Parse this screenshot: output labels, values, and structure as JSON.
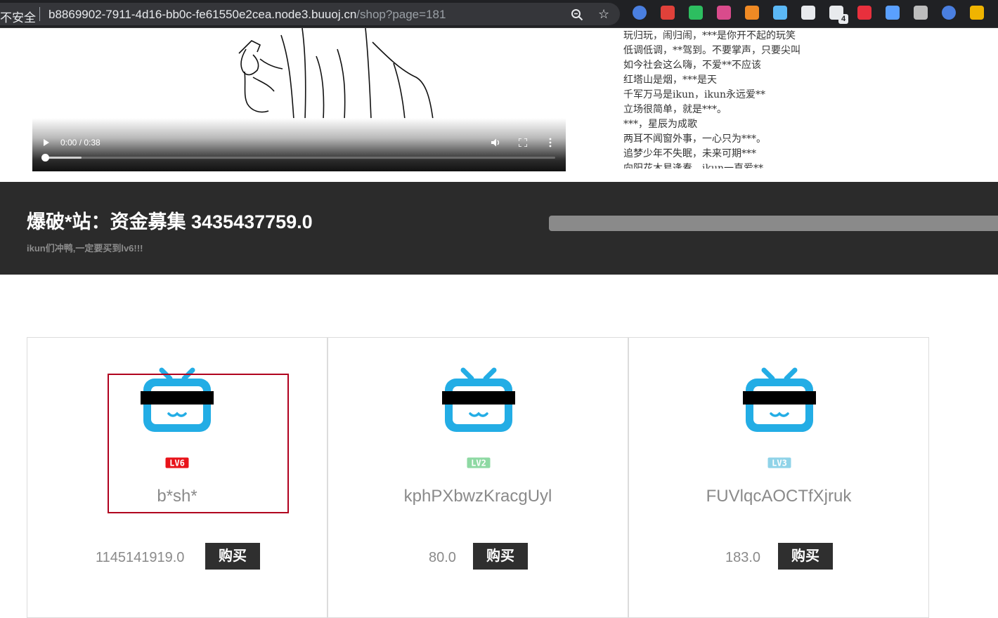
{
  "browser": {
    "security_label": "不安全",
    "url_host": "b8869902-7911-4d16-bb0c-fe61550e2cea.node3.buuoj.cn",
    "url_path": "/shop?page=181",
    "zoom_icon": "zoom-icon",
    "bookmark_icon": "star-icon",
    "extensions": [
      {
        "name": "globe-extension-icon",
        "color": "#4a7fe0"
      },
      {
        "name": "red-notes-extension-icon",
        "color": "#e0413a"
      },
      {
        "name": "evernote-extension-icon",
        "color": "#2dbe60"
      },
      {
        "name": "moon-extension-icon",
        "color": "#d94b8c"
      },
      {
        "name": "orange-tool-extension-icon",
        "color": "#f08a24"
      },
      {
        "name": "diamond-extension-icon",
        "color": "#5bb8f5"
      },
      {
        "name": "glasses-extension-icon",
        "color": "#e8eaed"
      },
      {
        "name": "cluster-extension-icon",
        "color": "#e8eaed"
      },
      {
        "name": "red-bookmark-extension-icon",
        "color": "#e8303d"
      },
      {
        "name": "pin-extension-icon",
        "color": "#5aa0ff"
      },
      {
        "name": "gear-extension-icon",
        "color": "#bdbdbd"
      },
      {
        "name": "help-extension-icon",
        "color": "#4a7fe0"
      },
      {
        "name": "md5-extension-icon",
        "color": "#f0b400"
      }
    ],
    "extension_badge": "4"
  },
  "video": {
    "time": "0:00 / 0:38",
    "progress": 0.0
  },
  "lyrics": [
    "玩归玩，闹归闹，***是你开不起的玩笑",
    "低调低调，**驾到。不要掌声，只要尖叫",
    "如今社会这么嗨，不爱**不应该",
    "红塔山是烟，***是天",
    "千军万马是ikun，ikun永远爱**",
    "立场很简单，就是***。",
    "***，星辰为成歌",
    "两耳不闻窗外事，一心只为***。",
    "追梦少年不失眠，未来可期***",
    "向阳花木易逢春，ikun一直爱**"
  ],
  "banner": {
    "title": "爆破*站：资金募集 3435437759.0",
    "subtitle": "ikun们冲鸭,一定要买到lv6!!!"
  },
  "products": [
    {
      "name": "b*sh*",
      "level": "LV6",
      "level_color": "#e8131a",
      "price": "1145141919.0",
      "buy_label": "购买"
    },
    {
      "name": "kphPXbwzKracgUyl",
      "level": "LV2",
      "level_color": "#8ed9a3",
      "price": "80.0",
      "buy_label": "购买"
    },
    {
      "name": "FUVlqcAOCTfXjruk",
      "level": "LV3",
      "level_color": "#8fd3e8",
      "price": "183.0",
      "buy_label": "购买"
    }
  ],
  "colors": {
    "tv_blue": "#23ade5",
    "banner_bg": "#2b2b2b",
    "highlight_red": "#b0001e"
  }
}
